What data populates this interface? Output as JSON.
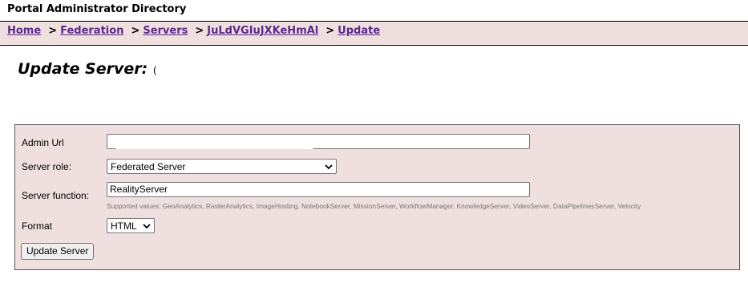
{
  "header": {
    "title": "Portal Administrator Directory"
  },
  "breadcrumb": {
    "separator": ">",
    "items": [
      "Home",
      "Federation",
      "Servers",
      "JuLdVGIuJXKeHmAl",
      "Update"
    ]
  },
  "page": {
    "title": "Update Server:",
    "title_suffix": "("
  },
  "form": {
    "admin_url": {
      "label": "Admin Url",
      "value": ""
    },
    "server_role": {
      "label": "Server role:",
      "selected": "Federated Server"
    },
    "server_function": {
      "label": "Server function:",
      "value": "RealityServer",
      "hint": "Supported values: GeoAnalytics, RasterAnalytics, ImageHosting, NotebookServer, MissionServer, WorkflowManager, KnowledgeServer, VideoServer, DataPipelinesServer, Velocity"
    },
    "format": {
      "label": "Format",
      "selected": "HTML"
    },
    "submit_label": "Update Server"
  },
  "colors": {
    "panel_bg": "#efdfdf",
    "link": "#5b2a8a"
  }
}
